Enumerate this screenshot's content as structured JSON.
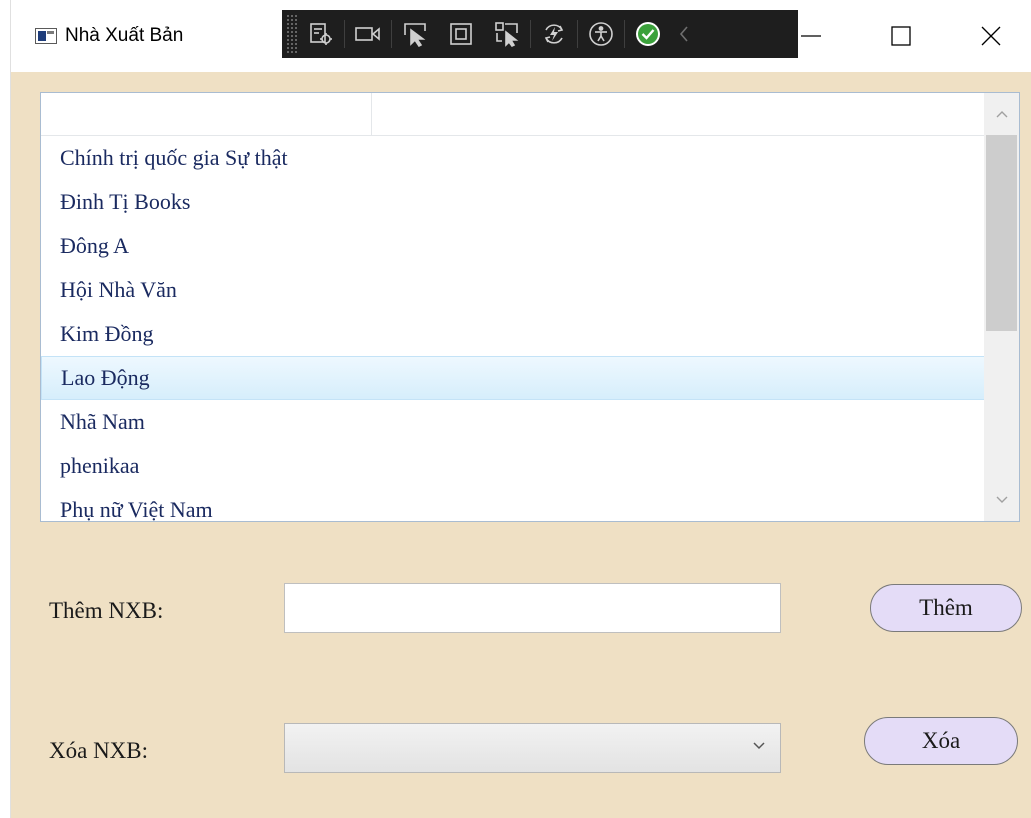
{
  "window": {
    "title": "Nhà Xuất Bản",
    "icons": [
      "app-window-icon",
      "minimize-icon",
      "maximize-icon",
      "close-icon"
    ]
  },
  "dev_toolbar": {
    "icons": [
      "live-visual-tree-icon",
      "record-video-icon",
      "select-element-icon",
      "display-layout-adorners-icon",
      "track-focused-element-icon",
      "hot-reload-icon",
      "accessibility-icon",
      "binding-ok-check-icon",
      "collapse-toolbar-icon"
    ],
    "accent_check_color": "#3ba13b"
  },
  "publishers": {
    "header_columns": [
      "",
      ""
    ],
    "items": [
      "Chính trị quốc gia Sự thật",
      "Đinh Tị Books",
      "Đông A",
      "Hội Nhà Văn",
      "Kim Đồng",
      "Lao Động",
      "Nhã Nam",
      "phenikaa",
      "Phụ nữ Việt Nam"
    ],
    "selected_index": 5
  },
  "add_form": {
    "label": "Thêm NXB:",
    "input_value": "",
    "button_label": "Thêm"
  },
  "delete_form": {
    "label": "Xóa NXB:",
    "selected_value": "",
    "button_label": "Xóa"
  },
  "colors": {
    "client_background": "#efe0c4",
    "button_background": "#e4dcf7",
    "list_text": "#1a2a60",
    "selection_gradient": [
      "#eef8fe",
      "#d6eefc"
    ]
  }
}
